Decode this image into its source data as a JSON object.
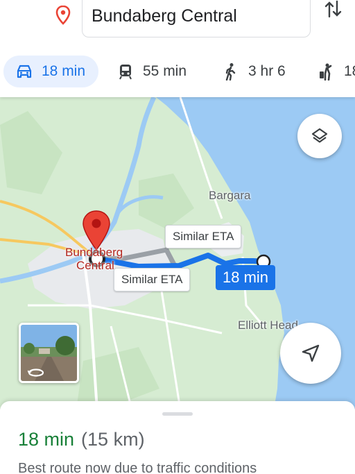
{
  "header": {
    "destination": "Bundaberg Central",
    "modes": [
      {
        "mode": "drive",
        "label": "18 min",
        "icon": "car-icon",
        "selected": true
      },
      {
        "mode": "transit",
        "label": "55 min",
        "icon": "train-icon",
        "selected": false
      },
      {
        "mode": "walk",
        "label": "3 hr 6",
        "icon": "walk-icon",
        "selected": false
      },
      {
        "mode": "ride",
        "label": "18",
        "icon": "ride-hail-icon",
        "selected": false
      }
    ]
  },
  "map": {
    "labels": {
      "bargara": "Bargara",
      "elliott": "Elliott Head",
      "city_line1": "Bundaberg",
      "city_line2": "Central"
    },
    "alt_route_1": "Similar ETA",
    "alt_route_2": "Similar ETA",
    "main_eta": "18 min",
    "colors": {
      "route": "#1a73e8",
      "alt_route": "#9aa0a6",
      "pin": "#ea4335",
      "ocean": "#9ccaf4",
      "land": "#d6ecd2"
    }
  },
  "sheet": {
    "time": "18 min",
    "distance": "(15 km)",
    "reason": "Best route now due to traffic conditions"
  }
}
